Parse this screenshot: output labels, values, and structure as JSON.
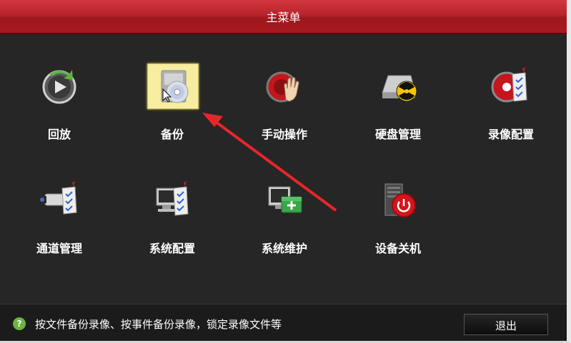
{
  "window": {
    "title": "主菜单"
  },
  "menu": [
    {
      "label": "回放",
      "icon": "playback-icon"
    },
    {
      "label": "备份",
      "icon": "backup-icon",
      "selected": true
    },
    {
      "label": "手动操作",
      "icon": "manual-operation-icon"
    },
    {
      "label": "硬盘管理",
      "icon": "hdd-management-icon"
    },
    {
      "label": "录像配置",
      "icon": "record-config-icon"
    },
    {
      "label": "通道管理",
      "icon": "camera-channel-icon"
    },
    {
      "label": "系统配置",
      "icon": "system-config-icon"
    },
    {
      "label": "系统维护",
      "icon": "system-maintenance-icon"
    },
    {
      "label": "设备关机",
      "icon": "shutdown-icon"
    }
  ],
  "status": {
    "help_icon": "?",
    "text": "按文件备份录像、按事件备份录像，锁定录像文件等"
  },
  "buttons": {
    "exit_label": "退出"
  },
  "colors": {
    "title_red": "#b8242a",
    "annotation_arrow": "#e8262a",
    "selection": "#f7eda0"
  }
}
